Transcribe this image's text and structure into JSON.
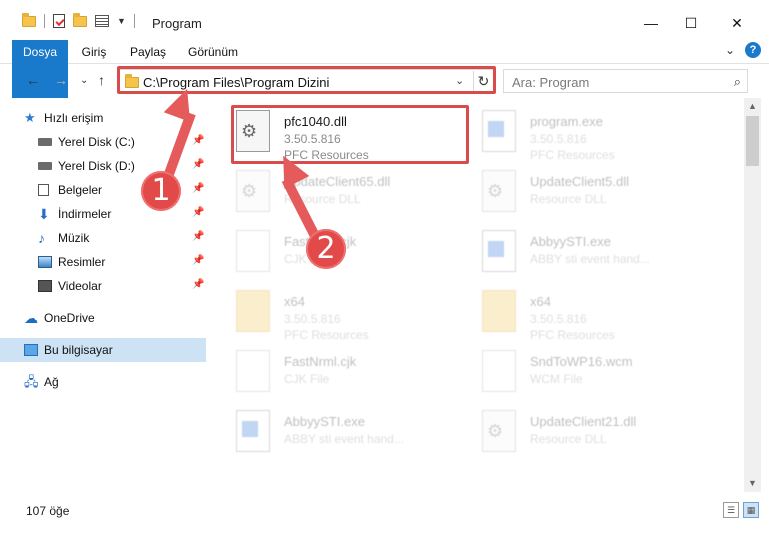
{
  "window": {
    "title": "Program",
    "controls": {
      "minimize": "—",
      "maximize": "☐",
      "close": "✕"
    }
  },
  "ribbon": {
    "tabs": [
      "Dosya",
      "Giriş",
      "Paylaş",
      "Görünüm"
    ],
    "expand_glyph": "⌄",
    "help_glyph": "?"
  },
  "nav": {
    "back": "←",
    "forward": "→",
    "recent": "⌄",
    "up": "↑",
    "address": "C:\\Program Files\\Program Dizini",
    "address_dropdown": "⌄",
    "refresh": "↻",
    "search_placeholder": "Ara: Program",
    "search_icon": "⌕"
  },
  "sidebar": {
    "quick_access": "Hızlı erişim",
    "items": [
      {
        "label": "Yerel Disk (C:)",
        "icon": "disk-icon",
        "pinned": true
      },
      {
        "label": "Yerel Disk (D:)",
        "icon": "disk-icon",
        "pinned": true
      },
      {
        "label": "Belgeler",
        "icon": "documents-icon",
        "pinned": true
      },
      {
        "label": "İndirmeler",
        "icon": "download-icon",
        "pinned": true
      },
      {
        "label": "Müzik",
        "icon": "music-icon",
        "pinned": true
      },
      {
        "label": "Resimler",
        "icon": "pictures-icon",
        "pinned": true
      },
      {
        "label": "Videolar",
        "icon": "videos-icon",
        "pinned": true
      }
    ],
    "onedrive": "OneDrive",
    "this_pc": "Bu bilgisayar",
    "network": "Ağ",
    "pin_glyph": "📌"
  },
  "files": [
    {
      "name": "pfc1040.dll",
      "line1": "3.50.5.816",
      "line2": "PFC Resources",
      "icon": "dll-file-icon",
      "highlight": true
    },
    {
      "name": "program.exe",
      "line1": "3.50.5.816",
      "line2": "PFC Resources",
      "icon": "exe-file-icon",
      "highlight": false
    },
    {
      "name": "UpdateClient65.dll",
      "line1": "Resource DLL",
      "line2": "",
      "icon": "dll-file-icon",
      "highlight": false
    },
    {
      "name": "UpdateClient5.dll",
      "line1": "Resource DLL",
      "line2": "",
      "icon": "dll-file-icon",
      "highlight": false
    },
    {
      "name": "FastNrml.cjk",
      "line1": "CJK File",
      "line2": "",
      "icon": "generic-file-icon",
      "highlight": false
    },
    {
      "name": "AbbyySTI.exe",
      "line1": "ABBY sti event hand...",
      "line2": "",
      "icon": "exe-file-icon",
      "highlight": false
    },
    {
      "name": "x64",
      "line1": "3.50.5.816",
      "line2": "PFC Resources",
      "icon": "folder-icon",
      "highlight": false
    },
    {
      "name": "x64",
      "line1": "3.50.5.816",
      "line2": "PFC Resources",
      "icon": "folder-icon",
      "highlight": false
    },
    {
      "name": "FastNrml.cjk",
      "line1": "CJK File",
      "line2": "",
      "icon": "generic-file-icon",
      "highlight": false
    },
    {
      "name": "SndToWP16.wcm",
      "line1": "WCM File",
      "line2": "",
      "icon": "generic-file-icon",
      "highlight": false
    },
    {
      "name": "AbbyySTI.exe",
      "line1": "ABBY sti event hand...",
      "line2": "",
      "icon": "exe-file-icon",
      "highlight": false
    },
    {
      "name": "UpdateClient21.dll",
      "line1": "Resource DLL",
      "line2": "",
      "icon": "dll-file-icon",
      "highlight": false
    }
  ],
  "status": {
    "item_count": "107 öğe"
  },
  "annotations": {
    "step1": "1",
    "step2": "2"
  },
  "colors": {
    "accent": "#1979ca",
    "callout": "#e24a4a",
    "selection": "#cde2f5"
  }
}
